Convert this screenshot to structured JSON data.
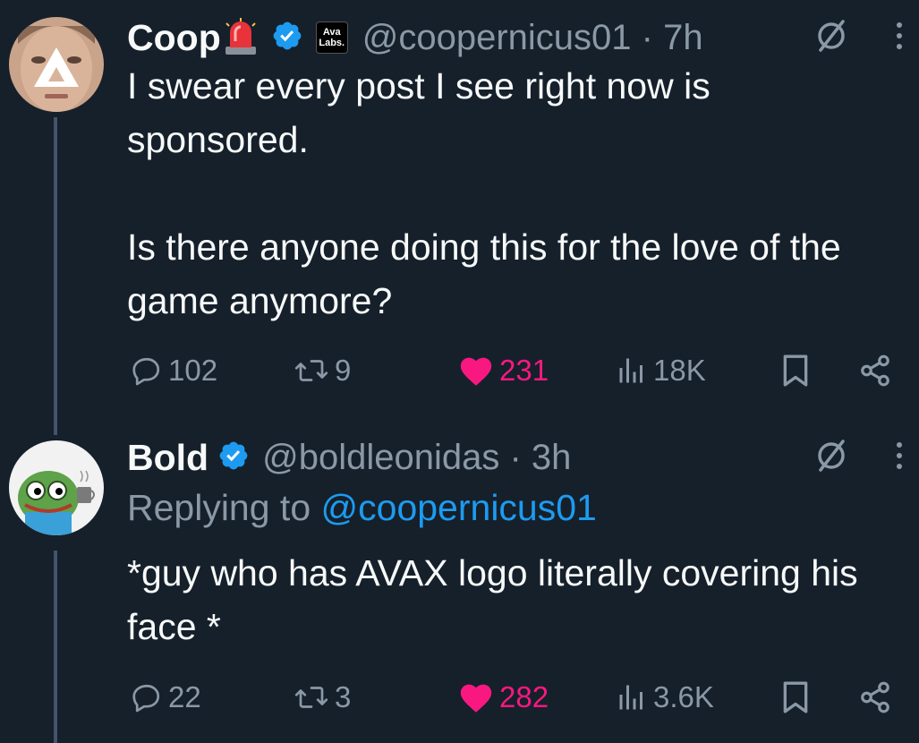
{
  "colors": {
    "background": "#15202b",
    "text_primary": "#f7f9f9",
    "text_secondary": "#8b98a5",
    "accent_blue": "#1d9bf0",
    "like_pink": "#f91880",
    "thread_line": "#42536a"
  },
  "posts": [
    {
      "author": {
        "display_name": "Coop",
        "name_emoji": "siren-icon",
        "verified": true,
        "affiliate_badge": [
          "Ava",
          "Labs."
        ],
        "handle": "@coopernicus01",
        "time": "7h",
        "handle_time": "@coopernicus01 · 7h"
      },
      "body": [
        "I swear every post I see right now is sponsored.",
        "Is there anyone doing this for the love of the game anymore?"
      ],
      "stats": {
        "replies": "102",
        "reposts": "9",
        "likes": "231",
        "views": "18K"
      },
      "liked": true
    },
    {
      "author": {
        "display_name": "Bold",
        "verified": true,
        "handle": "@boldleonidas",
        "time": "3h",
        "handle_time": "@boldleonidas · 3h"
      },
      "replying_to_label": "Replying to",
      "replying_to_handle": "@coopernicus01",
      "body": [
        "*guy who has AVAX logo literally covering his face *"
      ],
      "stats": {
        "replies": "22",
        "reposts": "3",
        "likes": "282",
        "views": "3.6K"
      },
      "liked": true
    }
  ]
}
